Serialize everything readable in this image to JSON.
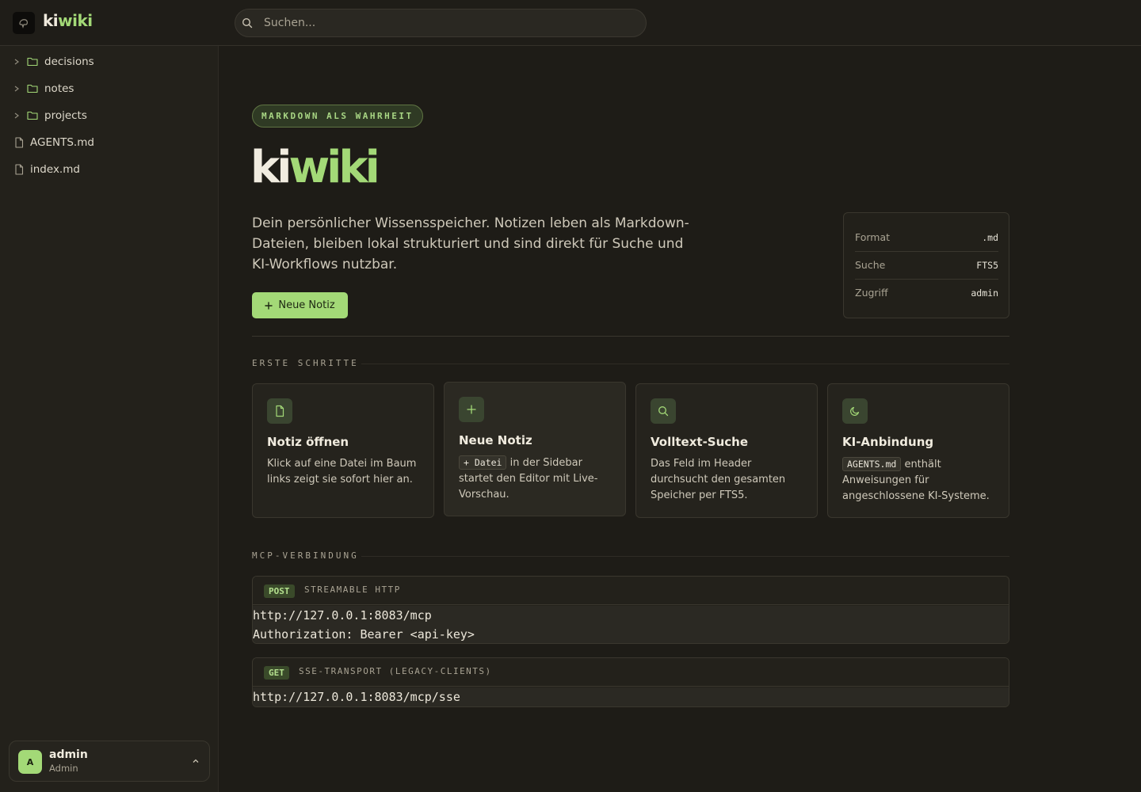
{
  "header": {
    "logo_ki": "ki",
    "logo_wiki": "wiki",
    "search_placeholder": "Suchen..."
  },
  "sidebar": {
    "items": [
      {
        "label": "decisions",
        "type": "folder"
      },
      {
        "label": "notes",
        "type": "folder"
      },
      {
        "label": "projects",
        "type": "folder"
      },
      {
        "label": "AGENTS.md",
        "type": "file"
      },
      {
        "label": "index.md",
        "type": "file"
      }
    ],
    "user": {
      "initial": "A",
      "name": "admin",
      "role": "Admin"
    }
  },
  "hero": {
    "pill": "MARKDOWN ALS WAHRHEIT",
    "title_ki": "ki",
    "title_wiki": "wiki",
    "description": "Dein persönlicher Wissensspeicher. Notizen leben als Markdown-Dateien, bleiben lokal strukturiert und sind direkt für Suche und KI-Workflows nutzbar.",
    "new_note_button": "Neue Notiz",
    "info": [
      {
        "key": "Format",
        "value": ".md"
      },
      {
        "key": "Suche",
        "value": "FTS5"
      },
      {
        "key": "Zugriff",
        "value": "admin"
      }
    ]
  },
  "getting_started": {
    "label": "ERSTE SCHRITTE",
    "cards": [
      {
        "title": "Notiz öffnen",
        "text": "Klick auf eine Datei im Baum links zeigt sie sofort hier an.",
        "icon": "file-icon"
      },
      {
        "title": "Neue Notiz",
        "chip": "+ Datei",
        "text": " in der Sidebar startet den Editor mit Live-Vorschau.",
        "icon": "plus-icon"
      },
      {
        "title": "Volltext-Suche",
        "text": "Das Feld im Header durchsucht den gesamten Speicher per FTS5.",
        "icon": "search-icon"
      },
      {
        "title": "KI-Anbindung",
        "chip": "AGENTS.md",
        "text": " enthält Anweisungen für angeschlossene KI-Systeme.",
        "icon": "moon-icon"
      }
    ]
  },
  "mcp": {
    "label": "MCP-VERBINDUNG",
    "endpoints": [
      {
        "method": "POST",
        "label": "STREAMABLE HTTP",
        "lines": [
          "http://127.0.0.1:8083/mcp",
          "Authorization: Bearer <api-key>"
        ]
      },
      {
        "method": "GET",
        "label": "SSE-TRANSPORT (LEGACY-CLIENTS)",
        "lines": [
          "http://127.0.0.1:8083/mcp/sse"
        ]
      }
    ]
  },
  "colors": {
    "accent": "#a3d977",
    "background": "#1e1c17",
    "sidebar": "#23211b"
  }
}
